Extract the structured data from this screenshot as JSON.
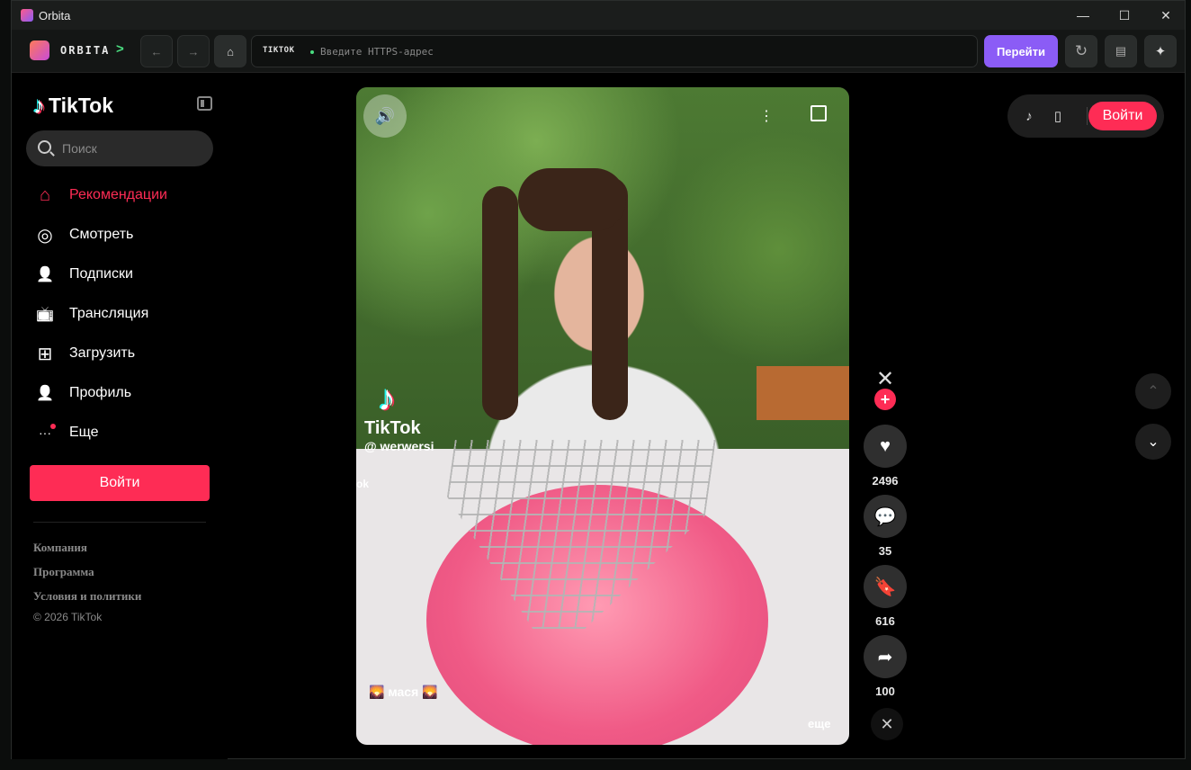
{
  "window": {
    "title": "Orbita",
    "minimize": "—",
    "maximize": "☐",
    "close": "✕"
  },
  "toolbar": {
    "brand": "ORBITA",
    "brand_chevron": ">",
    "back": "←",
    "forward": "→",
    "home": "⌂",
    "site_tag": "TIKTOK",
    "address_placeholder": "Введите HTTPS-адрес",
    "go_label": "Перейти",
    "reload": "↻",
    "menu": "▤",
    "ai": "✦",
    "accent": "#8b5cf6"
  },
  "sidebar": {
    "logo_text": "TikTok",
    "search_placeholder": "Поиск",
    "nav": [
      {
        "label": "Рекомендации",
        "icon": "home-icon",
        "glyph": "⌂",
        "active": true
      },
      {
        "label": "Смотреть",
        "icon": "compass-icon",
        "glyph": "◎"
      },
      {
        "label": "Подписки",
        "icon": "following-icon",
        "glyph": "👤"
      },
      {
        "label": "Трансляция",
        "icon": "live-tv-icon",
        "glyph": "📺"
      },
      {
        "label": "Загрузить",
        "icon": "upload-icon",
        "glyph": "⊞"
      },
      {
        "label": "Профиль",
        "icon": "profile-icon",
        "glyph": "👤"
      },
      {
        "label": "Еще",
        "icon": "more-icon",
        "glyph": "···"
      }
    ],
    "login_label": "Войти",
    "footer": [
      "Компания",
      "Программа",
      "Условия и политики"
    ],
    "copyright": "© 2026 TikTok",
    "brand_color": "#fe2c55"
  },
  "video": {
    "watermark": "TikTok",
    "watermark_user": "@ werwersi",
    "watermark_bottom": "ok",
    "caption": "🌄 мася 🌄",
    "more_label": "еще"
  },
  "actions": {
    "likes": "2496",
    "comments": "35",
    "saves": "616",
    "shares": "100"
  },
  "top_right": {
    "login_label": "Войти"
  }
}
